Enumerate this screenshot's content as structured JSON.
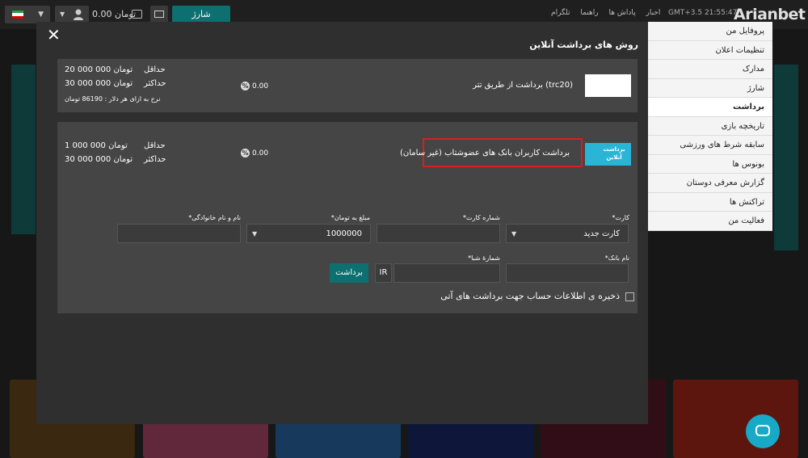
{
  "topbar": {
    "charge_label": "شارژ",
    "balance": "0.00 تومان",
    "nav_links": [
      "اخبار",
      "پاداش ها",
      "راهنما",
      "تلگرام"
    ],
    "clock": "GMT+3.5  21:55:47",
    "logo_part1": "Arian",
    "logo_part2": "bet"
  },
  "sidebar": {
    "items": [
      {
        "label": "پروفایل من"
      },
      {
        "label": "تنظیمات اعلان"
      },
      {
        "label": "مدارک"
      },
      {
        "label": "شارژ"
      },
      {
        "label": "برداشت",
        "active": true
      },
      {
        "label": "تاریخچه بازی"
      },
      {
        "label": "سابقه شرط های ورزشی"
      },
      {
        "label": "بونوس ها"
      },
      {
        "label": "گزارش معرفی دوستان"
      },
      {
        "label": "تراکنش ها"
      },
      {
        "label": "فعالیت من"
      }
    ]
  },
  "modal": {
    "title": "روش های برداشت آنلاین",
    "methods": [
      {
        "name": "(trc20) برداشت از طریق تتر",
        "fee": "0.00",
        "min_label": "حداقل",
        "min_value": "20 000 000 تومان",
        "max_label": "حداکثر",
        "max_value": "30 000 000 تومان",
        "rate": "نرخ به ازای هر دلار : 86190 تومان"
      },
      {
        "name": "برداشت کاربران بانک های عضوشتاب (غیر سامان)",
        "fee": "0.00",
        "min_label": "حداقل",
        "min_value": "1 000 000 تومان",
        "max_label": "حداکثر",
        "max_value": "30 000 000 تومان",
        "logo_text": "برداشت آنلاین"
      }
    ],
    "form": {
      "card_label": "کارت*",
      "card_value": "کارت جدید",
      "card_number_label": "شماره کارت*",
      "amount_label": "مبلغ به تومان*",
      "amount_value": "1000000",
      "fullname_label": "نام و نام خانوادگی*",
      "bank_label": "نام بانک*",
      "sheba_label": "شمارهٔ شبا*",
      "sheba_prefix": "IR",
      "withdraw_label": "برداشت",
      "save_label": "ذخیره ی اطلاعات حساب جهت برداشت های آتی"
    }
  },
  "colors": {
    "accent": "#0d6f6f",
    "highlight": "#d42020",
    "chat": "#18a9c6"
  }
}
